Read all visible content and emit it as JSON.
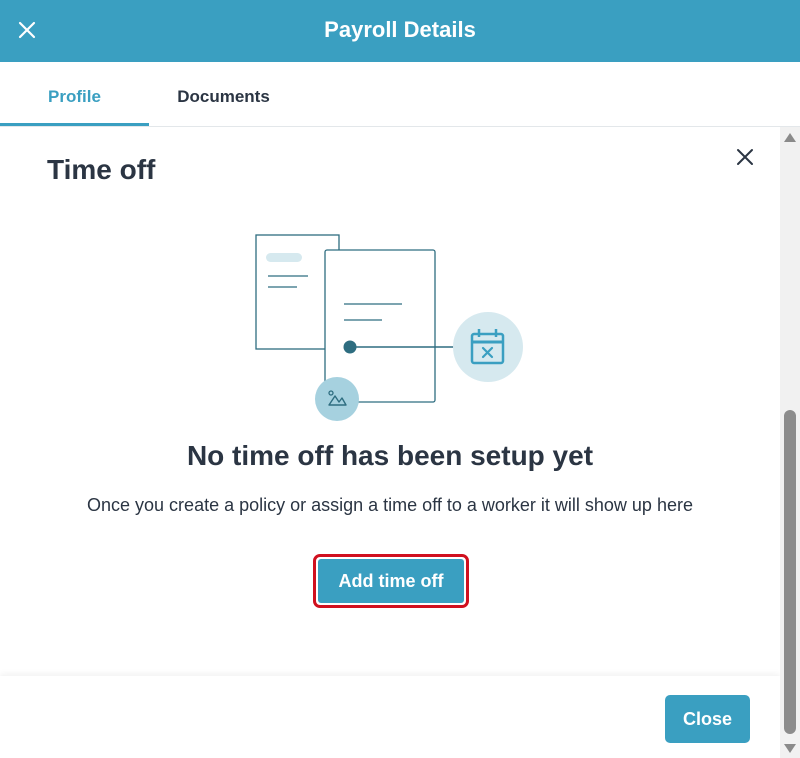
{
  "header": {
    "title": "Payroll Details"
  },
  "tabs": [
    {
      "label": "Profile",
      "active": true
    },
    {
      "label": "Documents",
      "active": false
    }
  ],
  "section": {
    "title": "Time off"
  },
  "empty_state": {
    "heading": "No time off has been setup yet",
    "description": "Once you create a policy or assign a time off to a worker it will show up here",
    "action_label": "Add time off"
  },
  "footer": {
    "close_label": "Close"
  },
  "colors": {
    "brand": "#3a9fc1",
    "highlight": "#d0101f",
    "text": "#2b3543"
  },
  "icons": [
    "close-icon",
    "calendar-x-icon",
    "image-icon",
    "document-icon"
  ]
}
